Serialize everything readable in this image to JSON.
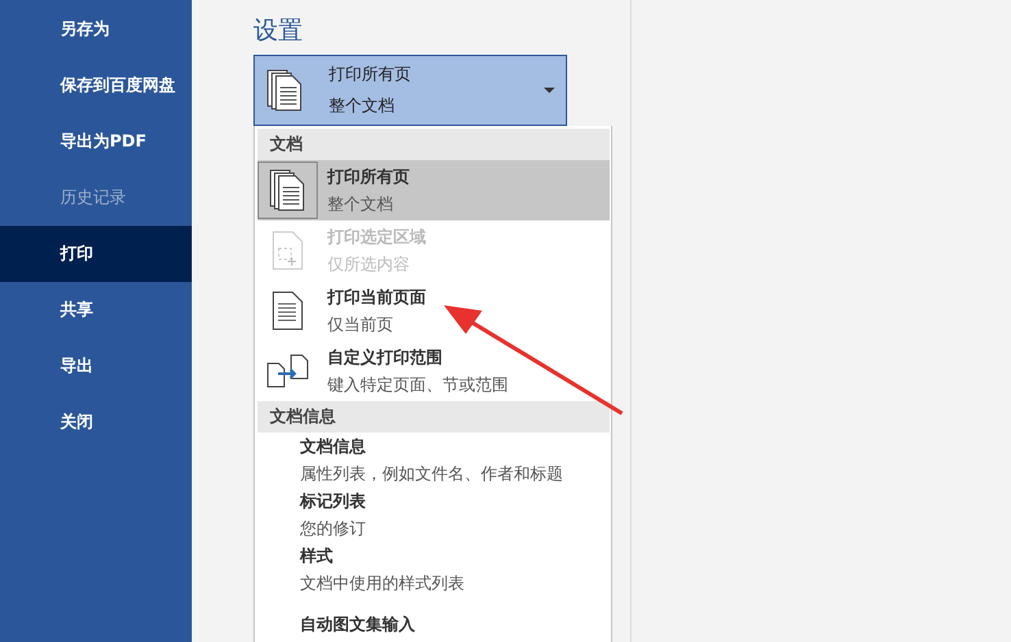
{
  "sidebar": {
    "items": [
      {
        "label": "另存为",
        "selected": false,
        "disabled": false
      },
      {
        "label": "保存到百度网盘",
        "selected": false,
        "disabled": false
      },
      {
        "label": "导出为PDF",
        "selected": false,
        "disabled": false
      },
      {
        "label": "历史记录",
        "selected": false,
        "disabled": true
      },
      {
        "label": "打印",
        "selected": true,
        "disabled": false
      },
      {
        "label": "共享",
        "selected": false,
        "disabled": false
      },
      {
        "label": "导出",
        "selected": false,
        "disabled": false
      },
      {
        "label": "关闭",
        "selected": false,
        "disabled": false
      }
    ]
  },
  "settings": {
    "heading": "设置",
    "dropdown": {
      "title": "打印所有页",
      "subtitle": "整个文档",
      "kind": "pages",
      "expanded": true
    },
    "menu": [
      {
        "heading": "文档",
        "items": [
          {
            "title": "打印所有页",
            "subtitle": "整个文档",
            "kind": "pages",
            "selected": true,
            "disabled": false
          },
          {
            "title": "打印选定区域",
            "subtitle": "仅所选内容",
            "kind": "selection",
            "selected": false,
            "disabled": true
          },
          {
            "title": "打印当前页面",
            "subtitle": "仅当前页",
            "kind": "page",
            "selected": false,
            "disabled": false
          },
          {
            "title": "自定义打印范围",
            "subtitle": "键入特定页面、节或范围",
            "kind": "range",
            "selected": false,
            "disabled": false
          }
        ]
      },
      {
        "heading": "文档信息",
        "items": [
          {
            "title": "文档信息",
            "subtitle": "属性列表，例如文件名、作者和标题",
            "kind": "text",
            "selected": false,
            "disabled": false
          },
          {
            "title": "标记列表",
            "subtitle": "您的修订",
            "kind": "text",
            "selected": false,
            "disabled": false
          },
          {
            "title": "样式",
            "subtitle": "文档中使用的样式列表",
            "kind": "text",
            "selected": false,
            "disabled": false
          },
          {
            "title": "自动图文集输入",
            "kind": "text",
            "selected": false,
            "disabled": false
          }
        ]
      }
    ]
  }
}
